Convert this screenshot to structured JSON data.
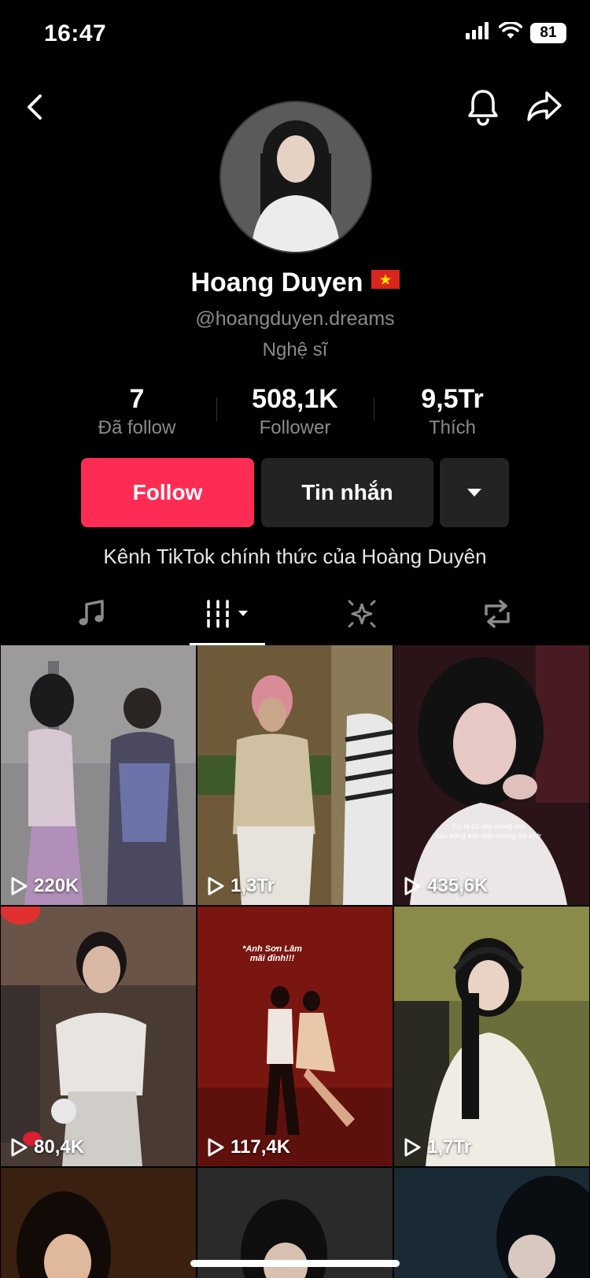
{
  "status_bar": {
    "time": "16:47",
    "battery": "81"
  },
  "profile": {
    "name": "Hoang Duyen",
    "handle": "@hoangduyen.dreams",
    "category": "Nghệ sĩ",
    "bio": "Kênh TikTok chính thức của Hoàng Duyên"
  },
  "stats": [
    {
      "value": "7",
      "label": "Đã follow"
    },
    {
      "value": "508,1K",
      "label": "Follower"
    },
    {
      "value": "9,5Tr",
      "label": "Thích"
    }
  ],
  "buttons": {
    "follow": "Follow",
    "message": "Tin nhắn"
  },
  "tabs": [
    {
      "icon": "music-note-icon"
    },
    {
      "icon": "videos-grid-icon",
      "active": true
    },
    {
      "icon": "sparkle-icon"
    },
    {
      "icon": "repost-icon"
    }
  ],
  "videos": [
    {
      "views": "220K",
      "color": "#8d8a8e"
    },
    {
      "views": "1,3Tr",
      "color": "#7a6a45"
    },
    {
      "views": "435,6K",
      "color": "#3a1a22"
    },
    {
      "views": "80,4K",
      "color": "#5a4238"
    },
    {
      "views": "117,4K",
      "color": "#8c1a14",
      "overlay": "*Anh Sơn Lâm\nmãi đỉnh!!!"
    },
    {
      "views": "1,7Tr",
      "color": "#55603a"
    },
    {
      "views": "",
      "color": "#3a2010"
    },
    {
      "views": "",
      "color": "#2a2a2a"
    },
    {
      "views": "",
      "color": "#1a2a34"
    }
  ],
  "overlay_captions": {
    "video3": "Có ta 23 dây mong mơ\nsâu trong ánh mắt những dài khờ"
  },
  "colors": {
    "accent": "#fe2c55",
    "button_dark": "#232323",
    "muted_text": "#8a8a8a"
  }
}
